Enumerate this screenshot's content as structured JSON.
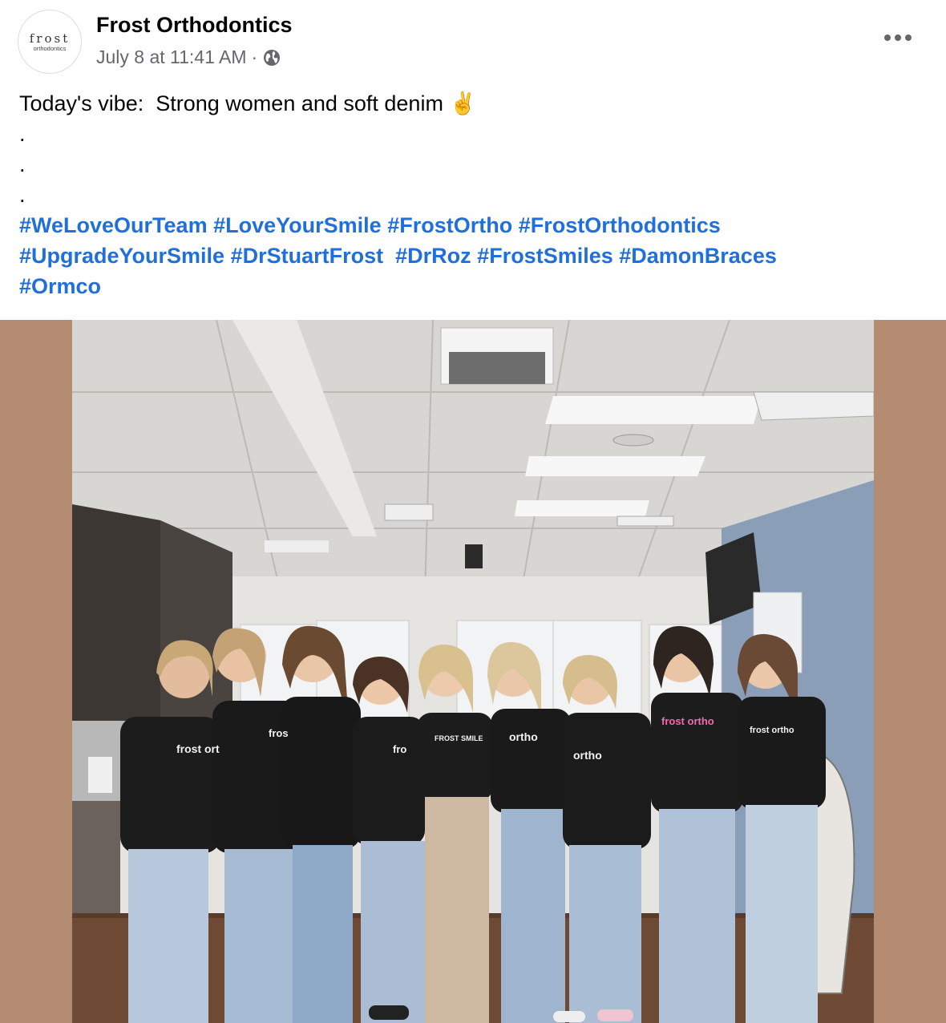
{
  "post": {
    "page_name": "Frost Orthodontics",
    "timestamp": "July 8 at 11:41 AM",
    "separator": "·",
    "privacy_icon": "globe-icon",
    "more_icon": "more-options-icon",
    "avatar_logo_main": "frost",
    "avatar_logo_sub": "orthodontics",
    "text_lines": [
      "Today's vibe:  Strong women and soft denim ✌️",
      ".",
      ".",
      "."
    ],
    "hashtags": [
      "#WeLoveOurTeam",
      "#LoveYourSmile",
      "#FrostOrtho",
      "#FrostOrthodontics",
      "#UpgradeYourSmile",
      "#DrStuartFrost",
      "#DrRoz",
      "#FrostSmiles",
      "#DamonBraces",
      "#Ormco"
    ]
  },
  "photo": {
    "background_color": "#b38c71",
    "shirt_texts": [
      "frost ort",
      "fros",
      "fro",
      "FROST SMILE",
      "ortho",
      "ortho",
      "frost ortho",
      "frost ortho"
    ]
  },
  "colors": {
    "link": "#216fdb",
    "secondary_text": "#65676b",
    "primary_text": "#050505"
  }
}
